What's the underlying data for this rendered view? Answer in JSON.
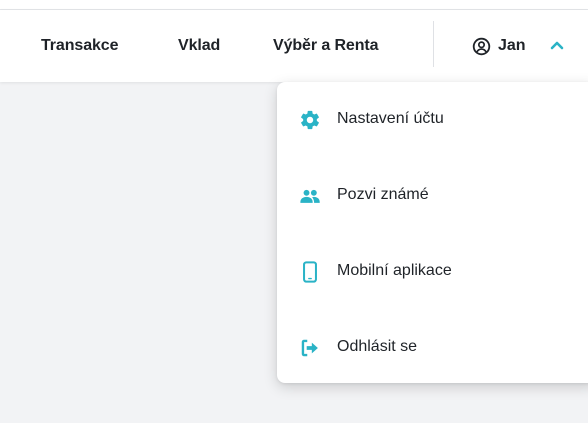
{
  "nav": {
    "links": [
      {
        "label": "Transakce"
      },
      {
        "label": "Vklad"
      },
      {
        "label": "Výběr a Renta"
      }
    ],
    "user": {
      "name": "Jan",
      "icon": "user-circle-icon",
      "chevron_icon": "chevron-up-icon"
    }
  },
  "user_menu": {
    "items": [
      {
        "label": "Nastavení účtu",
        "icon": "gear-icon"
      },
      {
        "label": "Pozvi známé",
        "icon": "users-icon"
      },
      {
        "label": "Mobilní aplikace",
        "icon": "mobile-phone-icon"
      },
      {
        "label": "Odhlásit se",
        "icon": "logout-icon"
      }
    ]
  },
  "colors": {
    "accent": "#2ab3c6",
    "text": "#1f2328",
    "background": "#f2f3f5"
  }
}
